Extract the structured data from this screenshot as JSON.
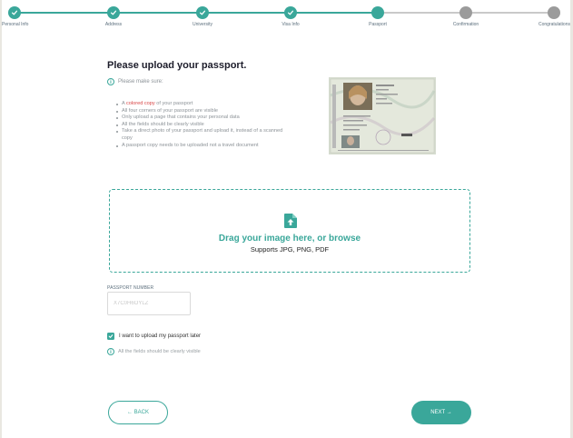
{
  "colors": {
    "accent": "#3aa79a",
    "inactive": "#9b9b9b",
    "highlight": "#d84545",
    "background": "#e9e7e1"
  },
  "stepper": {
    "steps": [
      {
        "label": "Personal Info",
        "state": "done"
      },
      {
        "label": "Address",
        "state": "done"
      },
      {
        "label": "University",
        "state": "done"
      },
      {
        "label": "Visa Info",
        "state": "done"
      },
      {
        "label": "Passport",
        "state": "current"
      },
      {
        "label": "Confirmation",
        "state": "todo"
      },
      {
        "label": "Congratulations",
        "state": "todo"
      }
    ]
  },
  "upload": {
    "title": "Please upload your passport.",
    "make_sure": "Please make sure:",
    "req0_prefix": "A ",
    "req0_highlight": "colored copy",
    "req0_suffix": " of your passport",
    "requirements": [
      "All four corners of your passport are visible",
      "Only upload a page that contains your personal data",
      "All the fields should be clearly visible",
      "Take a direct photo of your passport and upload it, instead of a scanned copy",
      "A passport copy needs to be uploaded not a travel document"
    ],
    "drop_text": "Drag your image here, or browse",
    "supports": "Supports JPG, PNG, PDF"
  },
  "passport_number": {
    "label": "PASSPORT NUMBER",
    "placeholder": "X7C0H6OYLZ"
  },
  "later_checkbox": {
    "label": "I want to upload my passport later",
    "checked": true
  },
  "hint": "All the fields should be clearly visible",
  "nav": {
    "back_label": "← BACK",
    "next_label": "NEXT →"
  },
  "icons": {
    "step_done": "check-icon",
    "info": "info-icon",
    "upload": "file-upload-icon",
    "checkbox": "checkmark-icon"
  }
}
